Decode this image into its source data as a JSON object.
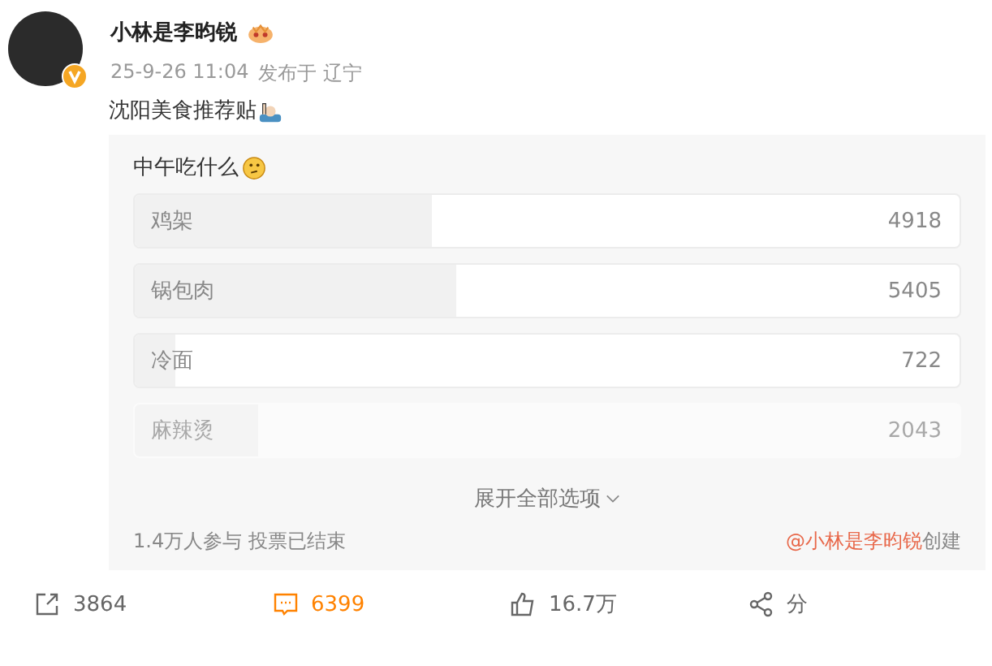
{
  "post": {
    "author": "小林是李昀锐",
    "time": "25-9-26 11:04",
    "location": "发布于 辽宁",
    "text": "沈阳美食推荐贴"
  },
  "poll": {
    "title": "中午吃什么",
    "options": [
      {
        "label": "鸡架",
        "count": "4918",
        "level": 0.36,
        "faded": false
      },
      {
        "label": "锅包肉",
        "count": "5405",
        "level": 0.39,
        "faded": false
      },
      {
        "label": "冷面",
        "count": "722",
        "level": 0.05,
        "faded": false
      },
      {
        "label": "麻辣烫",
        "count": "2043",
        "level": 0.15,
        "faded": true
      }
    ],
    "expand": "展开全部选项",
    "summary": "1.4万人参与 投票已结束",
    "creator_mention": "@小林是李昀锐",
    "creator_suffix": "创建"
  },
  "actions": [
    {
      "kind": "repost",
      "label": "3864",
      "selected": false
    },
    {
      "kind": "comment",
      "label": "6399",
      "selected": true
    },
    {
      "kind": "like",
      "label": "16.7万",
      "selected": false
    },
    {
      "kind": "share",
      "label": "分",
      "selected": false
    }
  ]
}
